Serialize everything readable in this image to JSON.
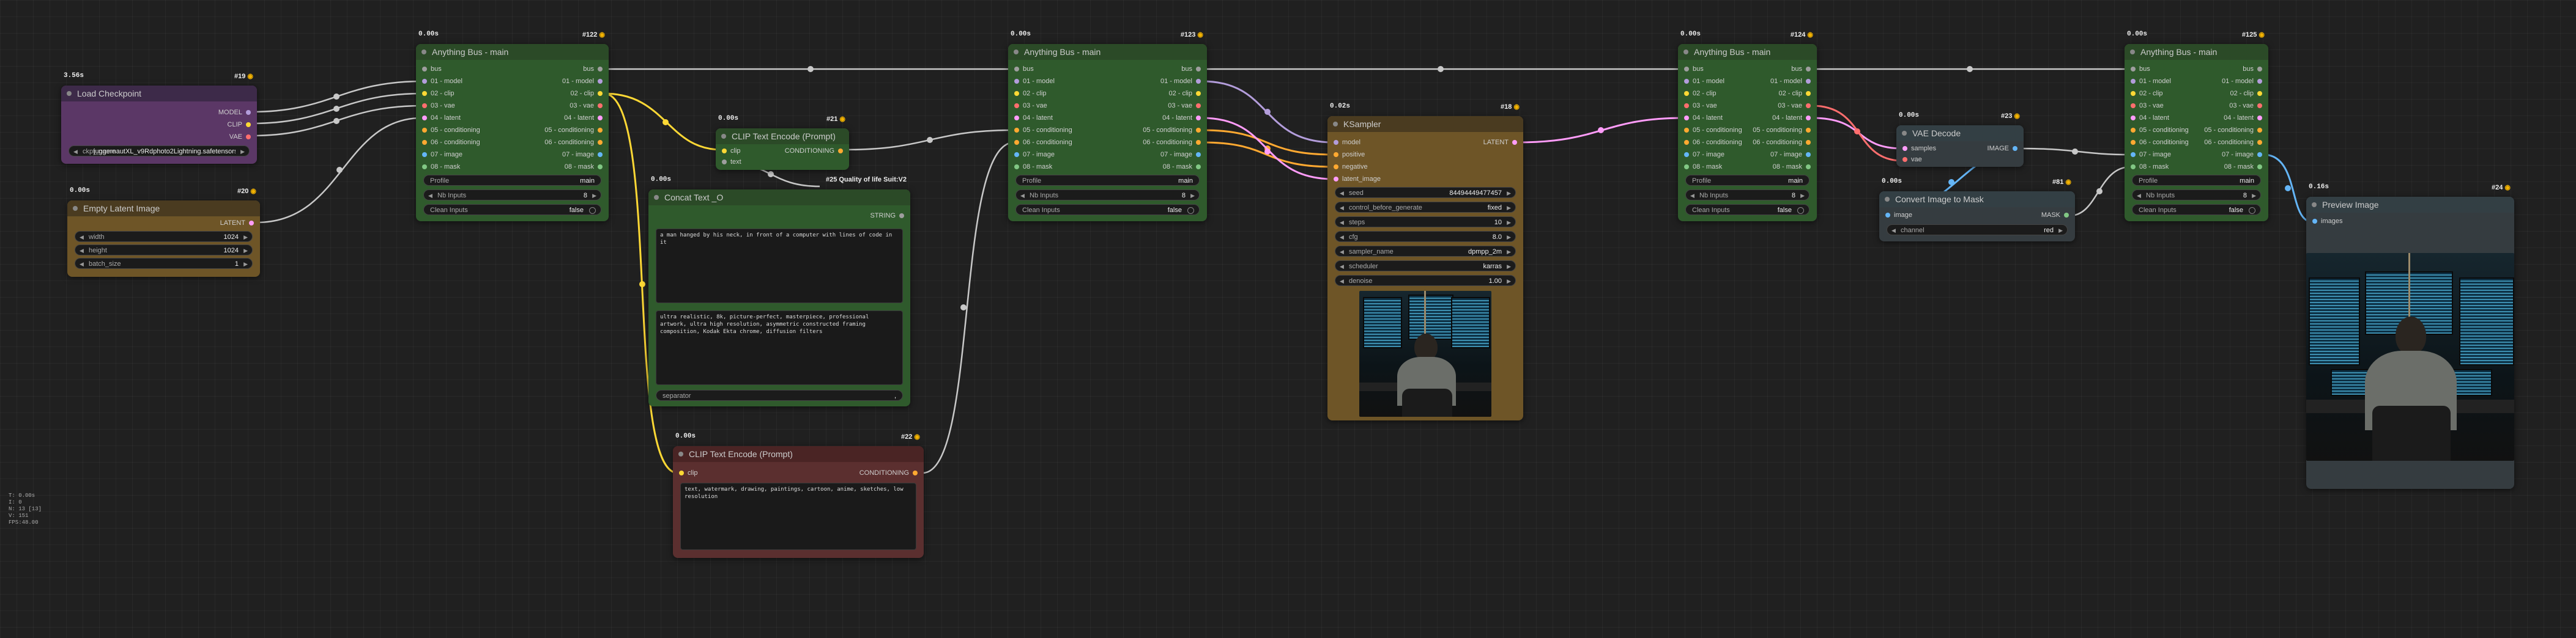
{
  "colors": {
    "green_title": "#2b4a27",
    "green_body": "#2f5a2c",
    "purple_title": "#3d2a49",
    "purple_body": "#5b3766",
    "brown_title": "#4a3b20",
    "brown_body": "#6e5527",
    "darkred_title": "#4a2424",
    "darkred_body": "#5b2f2f",
    "grey_title": "#333f44",
    "grey_body": "#353c40",
    "pin_model": "#b39ddb",
    "pin_clip": "#fdd835",
    "pin_vae": "#ff6e6e",
    "pin_cond": "#ffa931",
    "pin_latent": "#ff9cf9",
    "pin_image": "#64b5f6",
    "pin_mask": "#81c784",
    "pin_any": "#9e9e9e"
  },
  "stats": [
    "T: 0.00s",
    "I: 0",
    "N: 13 [13]",
    "V: 151",
    "FPS:48.00"
  ],
  "load_checkpoint": {
    "time": "3.56s",
    "id": "#19",
    "title": "Load Checkpoint",
    "outputs": [
      "MODEL",
      "CLIP",
      "VAE"
    ],
    "ckpt_label": "ckpt_name",
    "ckpt_value": "juggernautXL_v9Rdphoto2Lightning.safetensors"
  },
  "empty_latent": {
    "time": "0.00s",
    "id": "#20",
    "title": "Empty Latent Image",
    "output": "LATENT",
    "widgets": [
      {
        "label": "width",
        "value": "1024"
      },
      {
        "label": "height",
        "value": "1024"
      },
      {
        "label": "batch_size",
        "value": "1"
      }
    ]
  },
  "bus_122": {
    "time": "0.00s",
    "id": "#122",
    "title": "Anything Bus - main",
    "inputs": [
      "bus",
      "01 - model",
      "02 - clip",
      "03 - vae",
      "04 - latent",
      "05 - conditioning",
      "06 - conditioning",
      "07 - image",
      "08 - mask"
    ],
    "outputs": [
      "bus",
      "01 - model",
      "02 - clip",
      "03 - vae",
      "04 - latent",
      "05 - conditioning",
      "06 - conditioning",
      "07 - image",
      "08 - mask"
    ],
    "profile_label": "Profile",
    "profile_value": "main",
    "nb_label": "Nb Inputs",
    "nb_value": "8",
    "clean_label": "Clean Inputs",
    "clean_value": "false"
  },
  "bus_123": {
    "time": "0.00s",
    "id": "#123",
    "title": "Anything Bus - main",
    "inputs": [
      "bus",
      "01 - model",
      "02 - clip",
      "03 - vae",
      "04 - latent",
      "05 - conditioning",
      "06 - conditioning",
      "07 - image",
      "08 - mask"
    ],
    "outputs": [
      "bus",
      "01 - model",
      "02 - clip",
      "03 - vae",
      "04 - latent",
      "05 - conditioning",
      "06 - conditioning",
      "07 - image",
      "08 - mask"
    ],
    "profile_label": "Profile",
    "profile_value": "main",
    "nb_label": "Nb Inputs",
    "nb_value": "8",
    "clean_label": "Clean Inputs",
    "clean_value": "false"
  },
  "bus_124": {
    "time": "0.00s",
    "id": "#124",
    "title": "Anything Bus - main",
    "inputs": [
      "bus",
      "01 - model",
      "02 - clip",
      "03 - vae",
      "04 - latent",
      "05 - conditioning",
      "06 - conditioning",
      "07 - image",
      "08 - mask"
    ],
    "outputs": [
      "bus",
      "01 - model",
      "02 - clip",
      "03 - vae",
      "04 - latent",
      "05 - conditioning",
      "06 - conditioning",
      "07 - image",
      "08 - mask"
    ],
    "profile_label": "Profile",
    "profile_value": "main",
    "nb_label": "Nb Inputs",
    "nb_value": "8",
    "clean_label": "Clean Inputs",
    "clean_value": "false"
  },
  "bus_125": {
    "time": "0.00s",
    "id": "#125",
    "title": "Anything Bus - main",
    "inputs": [
      "bus",
      "01 - model",
      "02 - clip",
      "03 - vae",
      "04 - latent",
      "05 - conditioning",
      "06 - conditioning",
      "07 - image",
      "08 - mask"
    ],
    "outputs": [
      "bus",
      "01 - model",
      "02 - clip",
      "03 - vae",
      "04 - latent",
      "05 - conditioning",
      "06 - conditioning",
      "07 - image",
      "08 - mask"
    ],
    "profile_label": "Profile",
    "profile_value": "main",
    "nb_label": "Nb Inputs",
    "nb_value": "8",
    "clean_label": "Clean Inputs",
    "clean_value": "false"
  },
  "clip_pos": {
    "time": "0.00s",
    "id": "#21",
    "title": "CLIP Text Encode (Prompt)",
    "inputs": [
      "clip",
      "text"
    ],
    "output": "CONDITIONING"
  },
  "concat": {
    "time": "0.00s",
    "title": "Concat Text _O",
    "id_title": "#25 Quality of life Suit:V2",
    "output": "STRING",
    "text1": "a man hanged by his neck, in front of a computer with lines of code in it",
    "text2": "ultra realistic, 8k, picture-perfect, masterpiece, professional artwork, ultra high resolution, asymmetric constructed framing composition, Kodak Ekta chrome, diffusion filters",
    "separator_label": "separator",
    "separator_value": ","
  },
  "clip_neg": {
    "time": "0.00s",
    "id": "#22",
    "title": "CLIP Text Encode (Prompt)",
    "input": "clip",
    "output": "CONDITIONING",
    "text": "text, watermark, drawing, paintings, cartoon, anime, sketches, low resolution"
  },
  "ksampler": {
    "time": "0.02s",
    "id": "#18",
    "title": "KSampler",
    "inputs": [
      "model",
      "positive",
      "negative",
      "latent_image"
    ],
    "output": "LATENT",
    "widgets": [
      {
        "label": "seed",
        "value": "84494449477457"
      },
      {
        "label": "control_before_generate",
        "value": "fixed"
      },
      {
        "label": "steps",
        "value": "10"
      },
      {
        "label": "cfg",
        "value": "8.0"
      },
      {
        "label": "sampler_name",
        "value": "dpmpp_2m"
      },
      {
        "label": "scheduler",
        "value": "karras"
      },
      {
        "label": "denoise",
        "value": "1.00"
      }
    ]
  },
  "vae_decode": {
    "time": "0.00s",
    "id": "#23",
    "title": "VAE Decode",
    "inputs": [
      "samples",
      "vae"
    ],
    "output": "IMAGE"
  },
  "img_to_mask": {
    "time": "0.00s",
    "id": "#81",
    "title": "Convert Image to Mask",
    "input": "image",
    "output": "MASK",
    "channel_label": "channel",
    "channel_value": "red"
  },
  "preview": {
    "time": "0.16s",
    "id": "#24",
    "title": "Preview Image",
    "input": "images"
  }
}
